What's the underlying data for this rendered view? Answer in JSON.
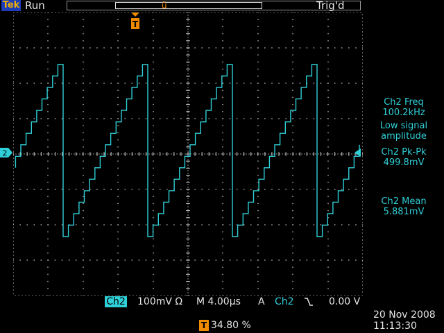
{
  "header": {
    "brand": "Tek",
    "acq_state": "Run",
    "trigger_state": "Trig'd"
  },
  "measurements": {
    "freq_label": "Ch2 Freq",
    "freq_value": "100.2kHz",
    "freq_note_1": "Low signal",
    "freq_note_2": "amplitude",
    "pkpk_label": "Ch2 Pk-Pk",
    "pkpk_value": "499.8mV",
    "mean_label": "Ch2 Mean",
    "mean_value": "5.881mV"
  },
  "markers": {
    "channel": "2",
    "trigger": "T"
  },
  "bottom": {
    "channel": "Ch2",
    "scale": "100mV Ω",
    "timebase": "M 4.00µs",
    "trigger_mode": "A",
    "trigger_source": "Ch2",
    "trigger_level": "0.00 V",
    "trigger_position": "34.80 %",
    "date": "20 Nov 2008",
    "time": "11:13:30"
  },
  "colors": {
    "trace": "#30d0d8",
    "accent": "#f08a00",
    "grid": "#bfbfbf"
  },
  "waveform": {
    "shape": "staircase-sawtooth",
    "cycles_visible": 4,
    "steps_per_cycle": 16
  }
}
